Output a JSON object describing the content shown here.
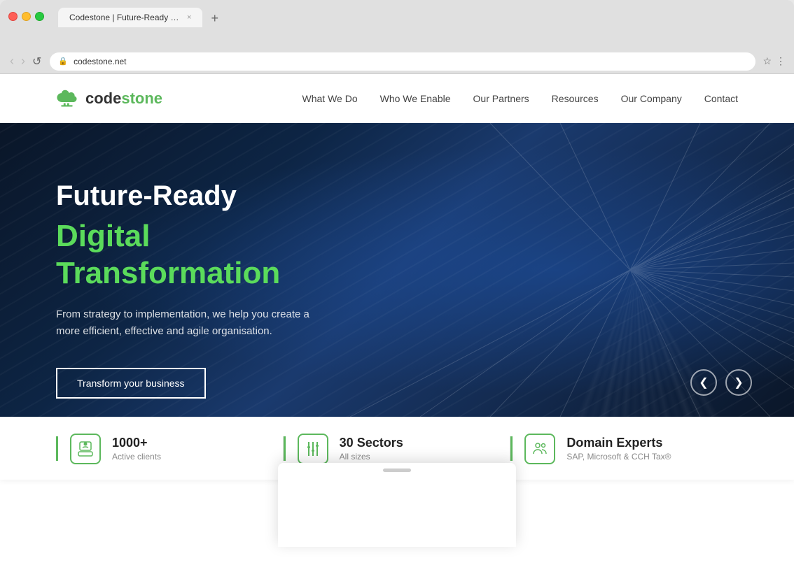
{
  "browser": {
    "tab_title": "Codestone | Future-Ready Digital Transformation",
    "tab_close": "×",
    "tab_new": "+",
    "nav_back": "‹",
    "nav_forward": "›",
    "nav_reload": "↺",
    "address_url": "codestone.net",
    "lock_icon": "🔒",
    "bookmark_icon": "☆",
    "menu_icon": "⋮"
  },
  "header": {
    "logo_text_dark": "code",
    "logo_text_green": "stone",
    "nav": {
      "item1": "What We Do",
      "item2": "Who We Enable",
      "item3": "Our Partners",
      "item4": "Resources",
      "item5": "Our Company",
      "item6": "Contact"
    }
  },
  "hero": {
    "title_white": "Future-Ready",
    "title_green": "Digital Transformation",
    "subtitle": "From strategy to implementation, we help you create a more efficient, effective and agile organisation.",
    "cta_label": "Transform your business",
    "carousel_prev": "❮",
    "carousel_next": "❯"
  },
  "stats": [
    {
      "icon": "👤",
      "number": "1000+",
      "label": "Active clients"
    },
    {
      "icon": "⚙",
      "number": "30 Sectors",
      "label": "All sizes"
    },
    {
      "icon": "👥",
      "number": "Domain Experts",
      "label": "SAP, Microsoft & CCH Tax®"
    }
  ]
}
